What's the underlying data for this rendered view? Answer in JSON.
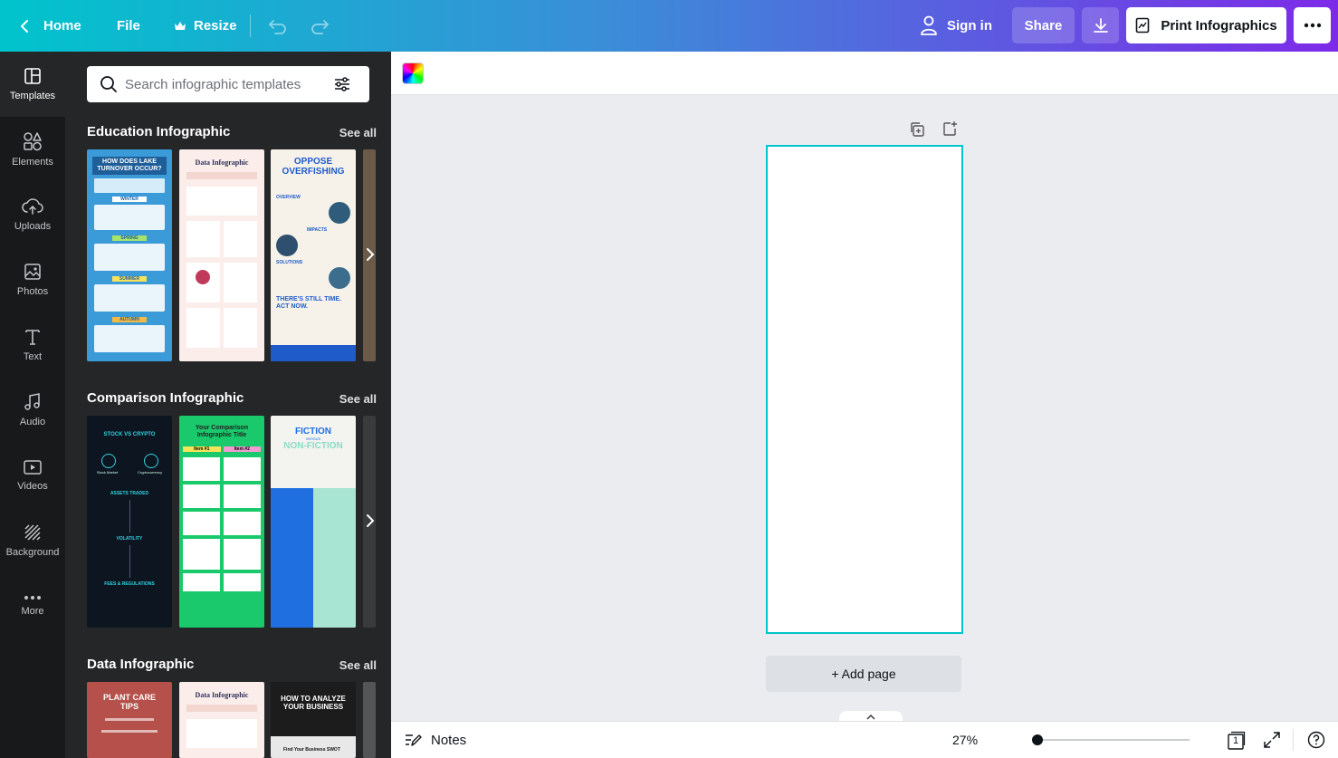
{
  "topbar": {
    "home_label": "Home",
    "file_label": "File",
    "resize_label": "Resize",
    "sign_in_label": "Sign in",
    "share_label": "Share",
    "print_label": "Print Infographics"
  },
  "rail": {
    "items": [
      {
        "label": "Templates",
        "icon": "templates-icon"
      },
      {
        "label": "Elements",
        "icon": "elements-icon"
      },
      {
        "label": "Uploads",
        "icon": "uploads-icon"
      },
      {
        "label": "Photos",
        "icon": "photos-icon"
      },
      {
        "label": "Text",
        "icon": "text-icon"
      },
      {
        "label": "Audio",
        "icon": "audio-icon"
      },
      {
        "label": "Videos",
        "icon": "videos-icon"
      },
      {
        "label": "Background",
        "icon": "background-icon"
      },
      {
        "label": "More",
        "icon": "more-icon"
      }
    ]
  },
  "search": {
    "placeholder": "Search infographic templates"
  },
  "sections": [
    {
      "title": "Education Infographic",
      "see_all": "See all",
      "templates": [
        {
          "heading": "HOW DOES LAKE TURNOVER OCCUR?",
          "labels": [
            "WINTER",
            "SPRING",
            "SUMMER",
            "AUTUMN"
          ]
        },
        {
          "heading": "Data Infographic"
        },
        {
          "heading": "OPPOSE OVERFISHING",
          "labels": [
            "OVERVIEW",
            "IMPACTS",
            "SOLUTIONS",
            "THERE'S STILL TIME. ACT NOW."
          ]
        }
      ]
    },
    {
      "title": "Comparison Infographic",
      "see_all": "See all",
      "templates": [
        {
          "heading": "STOCK VS CRYPTO",
          "labels": [
            "Stock Market",
            "Cryptocurrency",
            "ASSETS TRADED",
            "VOLATILITY",
            "FEES & REGULATIONS"
          ]
        },
        {
          "heading": "Your Comparison Infographic Title",
          "labels": [
            "Item #1",
            "Item #2"
          ]
        },
        {
          "heading": "FICTION",
          "labels": [
            "VERSUS",
            "NON-FICTION"
          ]
        }
      ]
    },
    {
      "title": "Data Infographic",
      "see_all": "See all",
      "templates": [
        {
          "heading": "PLANT CARE TIPS"
        },
        {
          "heading": "Data Infographic"
        },
        {
          "heading": "HOW TO ANALYZE YOUR BUSINESS",
          "labels": [
            "Find Your Business SWOT"
          ]
        }
      ]
    }
  ],
  "canvas": {
    "add_page_label": "+ Add page"
  },
  "footer": {
    "notes_label": "Notes",
    "zoom": "27%",
    "zoom_fraction": 0.0,
    "page_count": "1"
  },
  "colors": {
    "accent": "#00c4cc",
    "brand_purple": "#7d2ae8",
    "rail_bg": "#18191b",
    "panel_bg": "#252627"
  }
}
